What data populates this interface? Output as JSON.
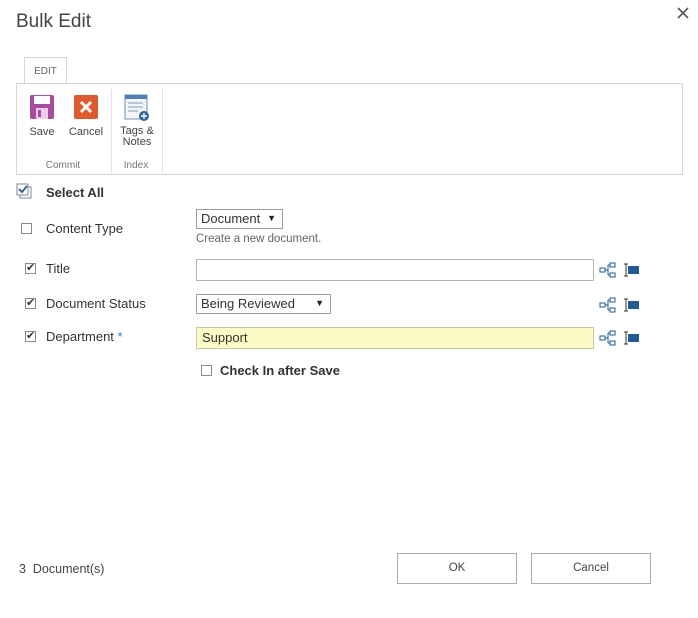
{
  "dialog": {
    "title": "Bulk Edit"
  },
  "ribbon": {
    "tab": "EDIT",
    "commit": {
      "label": "Commit",
      "save": "Save",
      "cancel": "Cancel"
    },
    "index": {
      "label": "Index",
      "tags_line1": "Tags &",
      "tags_line2": "Notes"
    }
  },
  "form": {
    "select_all": "Select All",
    "content_type": {
      "label": "Content Type",
      "value": "Document",
      "hint": "Create a new document."
    },
    "title": {
      "label": "Title",
      "value": ""
    },
    "document_status": {
      "label": "Document Status",
      "value": "Being Reviewed"
    },
    "department": {
      "label": "Department",
      "required_mark": "*",
      "value": "Support"
    },
    "check_in": "Check In after Save"
  },
  "footer": {
    "count": "3",
    "count_label": "Document(s)",
    "ok": "OK",
    "cancel": "Cancel"
  },
  "colors": {
    "save_purple": "#a94ba3",
    "cancel_orange": "#e0582c",
    "icon_blue": "#1f5c99",
    "field_highlight": "#fbfbc5"
  }
}
